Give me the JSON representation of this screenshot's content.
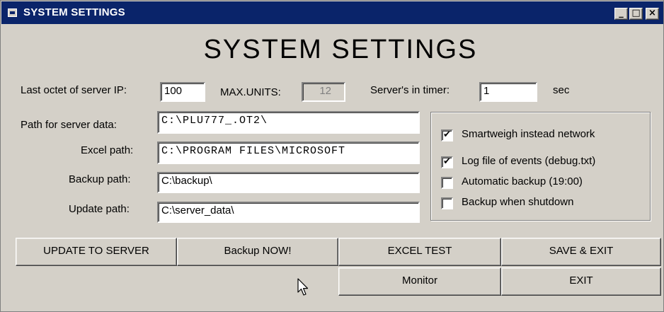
{
  "window": {
    "title": "SYSTEM SETTINGS",
    "controls": {
      "minimize": "_",
      "maximize": "□",
      "close": "×"
    }
  },
  "heading": "SYSTEM  SETTINGS",
  "server_ip": {
    "label": "Last octet of server IP:",
    "value": "100"
  },
  "max_units": {
    "label": "MAX.UNITS:",
    "value": "12"
  },
  "timer": {
    "label": "Server's in timer:",
    "value": "1",
    "unit": "sec"
  },
  "paths": {
    "server_data": {
      "label": "Path for server data:",
      "value": "C:\\PLU777_.OT2\\"
    },
    "excel": {
      "label": "Excel path:",
      "value": "C:\\PROGRAM FILES\\MICROSOFT"
    },
    "backup": {
      "label": "Backup path:",
      "value": "C:\\backup\\"
    },
    "update": {
      "label": "Update path:",
      "value": "C:\\server_data\\"
    }
  },
  "options": [
    {
      "label": "Smartweigh instead network",
      "checked": true
    },
    {
      "label": "Log file of events (debug.txt)",
      "checked": true
    },
    {
      "label": "Automatic backup (19:00)",
      "checked": false
    },
    {
      "label": "Backup when shutdown",
      "checked": false
    }
  ],
  "buttons": {
    "update_to_server": "UPDATE TO SERVER",
    "backup_now": "Backup NOW!",
    "excel_test": "EXCEL TEST",
    "save_exit": "SAVE & EXIT",
    "monitor": "Monitor",
    "exit": "EXIT"
  },
  "colors": {
    "titlebar": "#0a246a",
    "face": "#d4d0c8"
  },
  "icons": {
    "window": "app-window-icon",
    "cursor": "mouse-pointer-icon"
  }
}
